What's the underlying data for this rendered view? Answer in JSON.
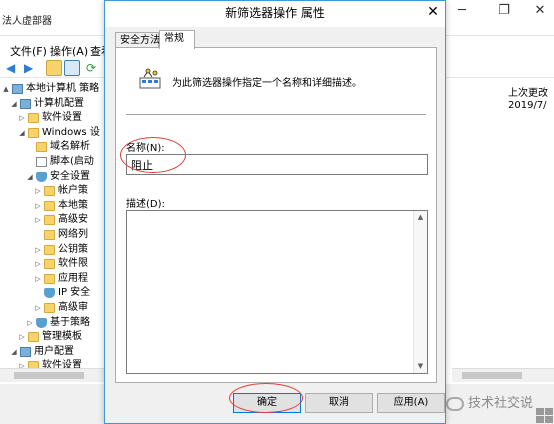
{
  "background_window": {
    "caption": "法人虚部器",
    "menu": [
      "文件(F)",
      "操作(A)",
      "查看"
    ],
    "tree": [
      {
        "label": "本地计算机 策略",
        "icon": "computer-icon",
        "indent": 0,
        "arrow": "▲"
      },
      {
        "label": "计算机配置",
        "icon": "computer-icon",
        "indent": 1,
        "arrow": "◢"
      },
      {
        "label": "软件设置",
        "icon": "folder-icon",
        "indent": 2,
        "arrow": "▷"
      },
      {
        "label": "Windows 设",
        "icon": "folder-icon",
        "indent": 2,
        "arrow": "◢"
      },
      {
        "label": "域名解析",
        "icon": "folder-icon",
        "indent": 3,
        "arrow": ""
      },
      {
        "label": "脚本(启动",
        "icon": "document-icon",
        "indent": 3,
        "arrow": ""
      },
      {
        "label": "安全设置",
        "icon": "shield-icon",
        "indent": 3,
        "arrow": "◢"
      },
      {
        "label": "帐户策",
        "icon": "folder-icon",
        "indent": 4,
        "arrow": "▷"
      },
      {
        "label": "本地策",
        "icon": "folder-icon",
        "indent": 4,
        "arrow": "▷"
      },
      {
        "label": "高级安",
        "icon": "folder-icon",
        "indent": 4,
        "arrow": "▷"
      },
      {
        "label": "网络列",
        "icon": "folder-icon",
        "indent": 4,
        "arrow": ""
      },
      {
        "label": "公钥策",
        "icon": "folder-icon",
        "indent": 4,
        "arrow": "▷"
      },
      {
        "label": "软件限",
        "icon": "folder-icon",
        "indent": 4,
        "arrow": "▷"
      },
      {
        "label": "应用程",
        "icon": "folder-icon",
        "indent": 4,
        "arrow": "▷"
      },
      {
        "label": "IP 安全",
        "icon": "shield-icon",
        "indent": 4,
        "arrow": ""
      },
      {
        "label": "高级审",
        "icon": "folder-icon",
        "indent": 4,
        "arrow": "▷"
      },
      {
        "label": "基于策略",
        "icon": "chart-icon",
        "indent": 3,
        "arrow": "▷"
      },
      {
        "label": "管理模板",
        "icon": "folder-icon",
        "indent": 2,
        "arrow": "▷"
      },
      {
        "label": "用户配置",
        "icon": "computer-icon",
        "indent": 1,
        "arrow": "◢"
      },
      {
        "label": "软件设置",
        "icon": "folder-icon",
        "indent": 2,
        "arrow": "▷"
      }
    ],
    "right_pane": {
      "column_header": "上次更改",
      "first_cell": "2019/7/"
    },
    "watermark": "技术社交说"
  },
  "dialog": {
    "title": "新筛选器操作 属性",
    "close_glyph": "✕",
    "tabs": [
      "安全方法",
      "常规"
    ],
    "active_tab": 1,
    "description": "为此筛选器操作指定一个名称和详细描述。",
    "name_label": "名称(N):",
    "name_value": "阻止",
    "description_label": "描述(D):",
    "description_value": "",
    "buttons": {
      "ok": "确定",
      "cancel": "取消",
      "apply": "应用(A)"
    }
  },
  "colors": {
    "dialog_border": "#3a9ad9",
    "annotation": "#e0403a",
    "default_button_border": "#0078d7"
  }
}
